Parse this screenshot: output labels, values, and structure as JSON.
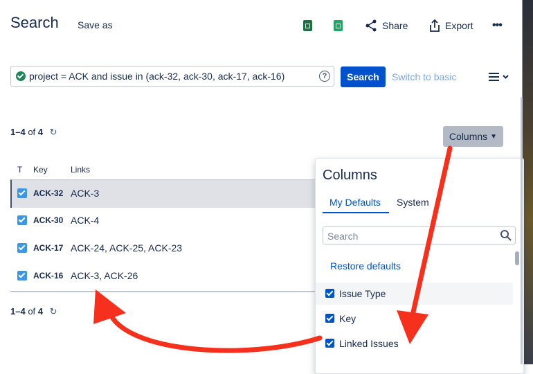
{
  "header": {
    "title": "Search",
    "save_as": "Save as",
    "share": "Share",
    "export": "Export",
    "more": "•••"
  },
  "search_bar": {
    "jql": "project = ACK and issue in (ack-32, ack-30, ack-17, ack-16)",
    "help": "?",
    "search_button": "Search",
    "switch_basic": "Switch to basic"
  },
  "results": {
    "count_range": "1–4",
    "count_of": "of",
    "count_total": "4",
    "columns_button": "Columns",
    "headers": {
      "type": "T",
      "key": "Key",
      "links": "Links"
    },
    "rows": [
      {
        "key": "ACK-32",
        "links": "ACK-3",
        "selected": true
      },
      {
        "key": "ACK-30",
        "links": "ACK-4",
        "selected": false
      },
      {
        "key": "ACK-17",
        "links": "ACK-24, ACK-25, ACK-23",
        "selected": false
      },
      {
        "key": "ACK-16",
        "links": "ACK-3, ACK-26",
        "selected": false
      }
    ]
  },
  "columns_panel": {
    "title": "Columns",
    "tabs": [
      "My Defaults",
      "System"
    ],
    "search_placeholder": "Search",
    "restore_defaults": "Restore defaults",
    "items": [
      {
        "label": "Issue Type",
        "checked": true
      },
      {
        "label": "Key",
        "checked": true
      },
      {
        "label": "Linked Issues",
        "checked": true
      }
    ]
  },
  "colors": {
    "primary": "#0052cc",
    "annotation_arrow": "#f5301c",
    "selected_row": "#dfe1e6"
  }
}
